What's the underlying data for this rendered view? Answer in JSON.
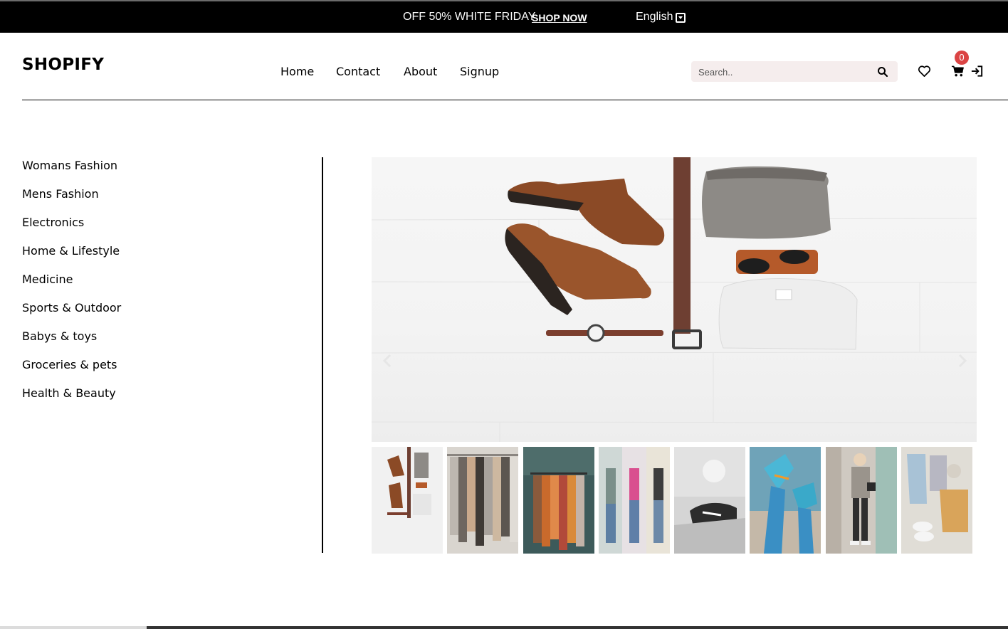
{
  "topbar": {
    "promo_text": "OFF 50% WHITE FRIDAY",
    "cta_label": "SHOP NOW",
    "language": "English"
  },
  "header": {
    "logo": "SHOPIFY",
    "nav": [
      "Home",
      "Contact",
      "About",
      "Signup"
    ],
    "search_placeholder": "Search..",
    "cart_count": "0",
    "icons": [
      "search-icon",
      "heart-icon",
      "cart-icon",
      "login-icon"
    ]
  },
  "sidebar": {
    "categories": [
      "Womans Fashion",
      "Mens Fashion",
      "Electronics",
      "Home & Lifestyle",
      "Medicine",
      "Sports & Outdoor",
      "Babys & toys",
      "Groceries & pets",
      "Health & Beauty"
    ]
  },
  "carousel": {
    "thumbnail_count": 8,
    "active_index": 0
  },
  "colors": {
    "topbar_bg": "#000000",
    "accent": "#db4444",
    "search_bg": "#f5eded"
  }
}
